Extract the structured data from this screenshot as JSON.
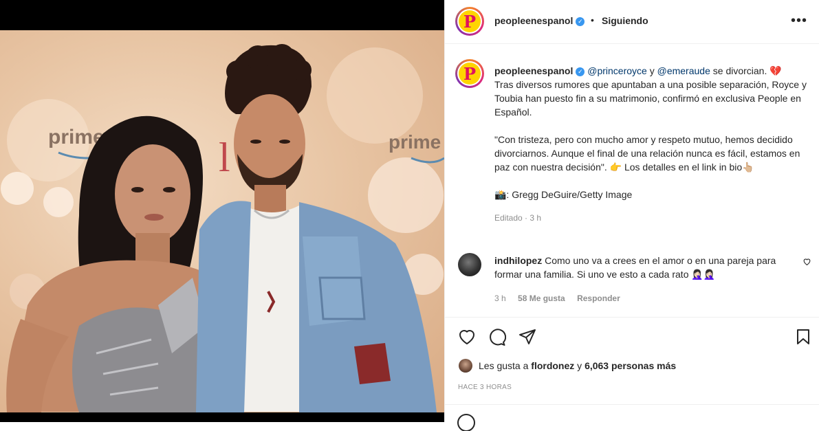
{
  "post": {
    "photo_alt": "",
    "bg_brand_text": "prime vi",
    "bg_brand_text_right": "prime"
  },
  "header": {
    "username": "peopleenespanol",
    "dot": "•",
    "follow_status": "Siguiendo",
    "more_icon": "more-horizontal-icon"
  },
  "caption": {
    "username": "peopleenespanol",
    "mention1": "@princeroyce",
    "conj": " y ",
    "mention2": "@emeraude",
    "headline_rest": " se divorcian. 💔",
    "body1": "Tras diversos rumores que apuntaban a una posible separación, Royce y Toubia han puesto fin a su matrimonio, confirmó en exclusiva People en Español.",
    "body2": "\"Con tristeza, pero con mucho amor y respeto mutuo, hemos decidido divorciarnos. Aunque el final de una relación nunca es fácil, estamos en paz con nuestra decisión\". 👉 Los detalles en el link in bio👆🏼",
    "body3": "📸: Gregg DeGuire/Getty Image",
    "edited": "Editado · 3 h"
  },
  "comment": {
    "username": "indhilopez",
    "text": "Como uno va a crees en el amor o en una pareja para formar una familia. Si uno ve esto a cada rato 🤦🏻‍♀️🤦🏻‍♀️",
    "time": "3 h",
    "likes": "58 Me gusta",
    "reply": "Responder"
  },
  "likes": {
    "prefix": "Les gusta a ",
    "user": "flordonez",
    "suffix": " y ",
    "count": "6,063 personas más"
  },
  "timestamp": "HACE 3 HORAS",
  "colors": {
    "verified": "#3897f0",
    "logo_bg": "#ffd400",
    "logo_fg": "#e0115f",
    "mention": "#00376b"
  }
}
